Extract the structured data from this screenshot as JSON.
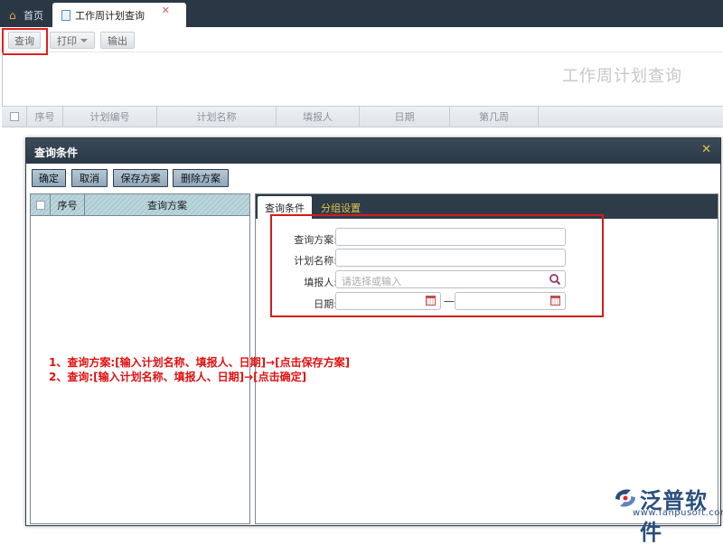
{
  "tabs": {
    "home": "首页",
    "current": "工作周计划查询"
  },
  "toolbar": {
    "query": "查询",
    "print": "打印",
    "export": "输出"
  },
  "page": {
    "title": "工作周计划查询"
  },
  "grid": {
    "columns": [
      "序号",
      "计划编号",
      "计划名称",
      "填报人",
      "日期",
      "第几周"
    ]
  },
  "dialog": {
    "title": "查询条件",
    "buttons": {
      "ok": "确定",
      "cancel": "取消",
      "save": "保存方案",
      "delete": "删除方案"
    },
    "left_columns": [
      "序号",
      "查询方案"
    ],
    "tabs": [
      "查询条件",
      "分组设置"
    ],
    "form": {
      "scheme_label": "查询方案:",
      "plan_name_label": "计划名称:",
      "reporter_label": "填报人:",
      "reporter_placeholder": "请选择或输入",
      "date_label": "日期:",
      "date_separator": "—"
    }
  },
  "notes": [
    "1、查询方案:[输入计划名称、填报人、日期]→[点击保存方案]",
    "2、查询:[输入计划名称、填报人、日期]→[点击确定]"
  ],
  "logo": {
    "name": "泛普软件",
    "url": "www.fanpusoft.com"
  },
  "colors": {
    "header_dark": "#2a3846",
    "highlight_red": "#e02020",
    "accent_yellow": "#e3c44b",
    "logo_blue": "#2a4f7e"
  }
}
